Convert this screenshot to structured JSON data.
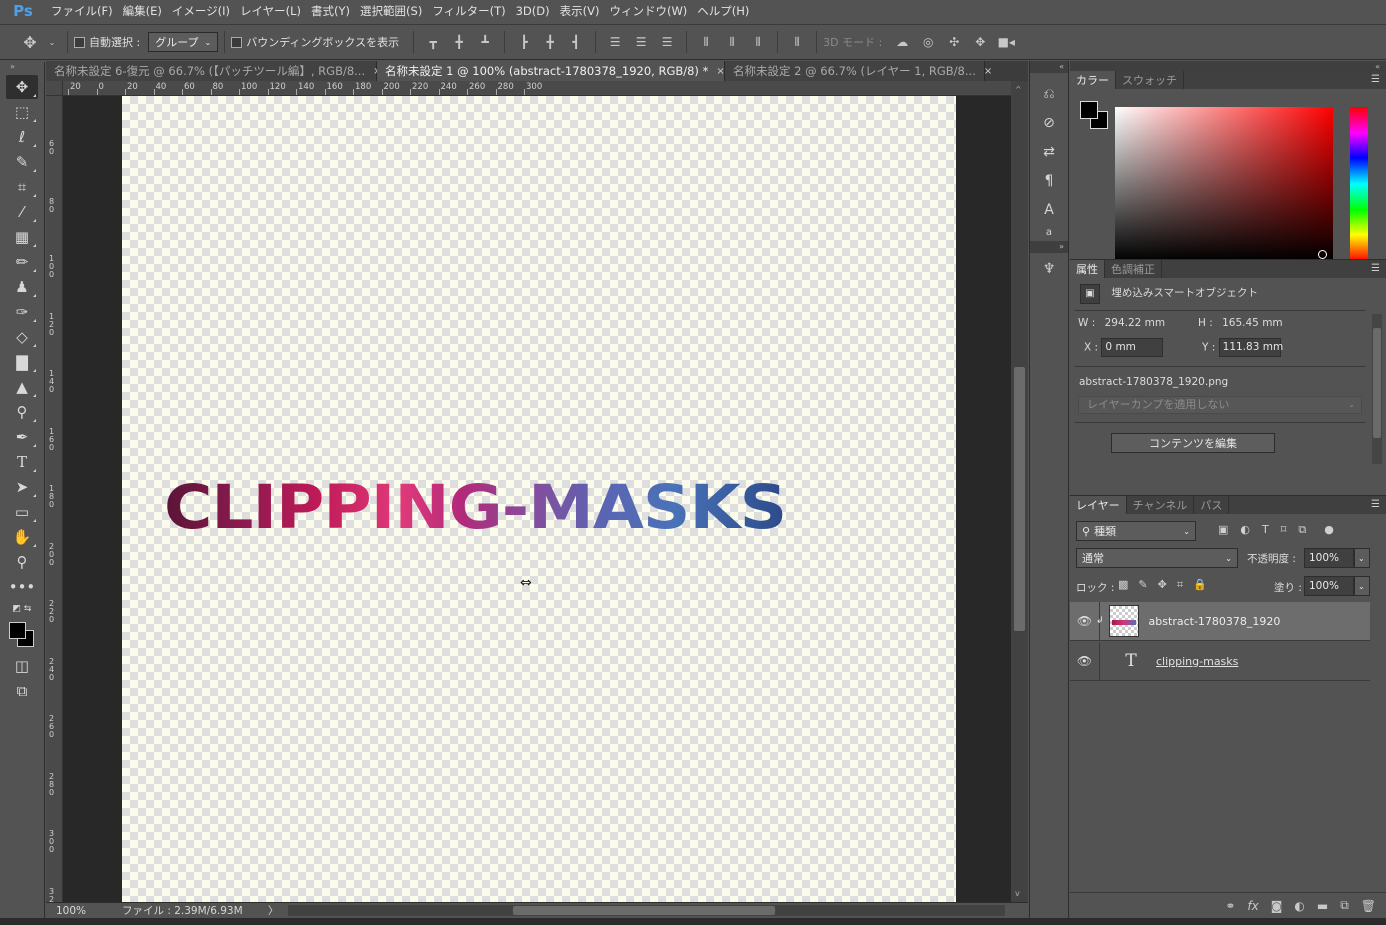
{
  "app": {
    "logo": "Ps"
  },
  "menu": [
    "ファイル(F)",
    "編集(E)",
    "イメージ(I)",
    "レイヤー(L)",
    "書式(Y)",
    "選択範囲(S)",
    "フィルター(T)",
    "3D(D)",
    "表示(V)",
    "ウィンドウ(W)",
    "ヘルプ(H)"
  ],
  "options": {
    "auto_select_label": "自動選択 :",
    "auto_select_value": "グループ",
    "bbox_label": "バウンディングボックスを表示",
    "mode3d_label": "3D モード :"
  },
  "tabs": [
    {
      "label": "名称未設定 6-復元 @ 66.7% (【パッチツール編】, RGB/8...",
      "close": "×"
    },
    {
      "label": "名称未設定 1 @ 100% (abstract-1780378_1920, RGB/8) *",
      "close": "×"
    },
    {
      "label": "名称未設定 2 @ 66.7% (レイヤー 1, RGB/8...",
      "close": "×"
    }
  ],
  "ruler_top": [
    "20",
    "0",
    "20",
    "40",
    "60",
    "80",
    "100",
    "120",
    "140",
    "160",
    "180",
    "200",
    "220",
    "240",
    "260",
    "280",
    "300"
  ],
  "ruler_left": [
    "6 0",
    "8 0",
    "1 0 0",
    "1 2 0",
    "1 4 0",
    "1 6 0",
    "1 8 0",
    "2 0 0",
    "2 2 0",
    "2 4 0",
    "2 6 0",
    "2 8 0",
    "3 0 0",
    "3 2 0"
  ],
  "canvas": {
    "text": "CLIPPING-MASKS"
  },
  "status": {
    "zoom": "100%",
    "file": "ファイル : 2.39M/6.93M",
    "arrow": "〉"
  },
  "color_panel": {
    "tabs": [
      "カラー",
      "スウォッチ"
    ]
  },
  "properties": {
    "tabs": [
      "属性",
      "色調補正"
    ],
    "type": "埋め込みスマートオブジェクト",
    "w_label": "W :",
    "w_value": "294.22 mm",
    "h_label": "H :",
    "h_value": "165.45 mm",
    "x_label": "X :",
    "x_value": "0 mm",
    "y_label": "Y :",
    "y_value": "111.83 mm",
    "filename": "abstract-1780378_1920.png",
    "comp_placeholder": "レイヤーカンプを適用しない",
    "edit_button": "コンテンツを編集"
  },
  "layers": {
    "tabs": [
      "レイヤー",
      "チャンネル",
      "パス"
    ],
    "filter_label": "種類",
    "blend_mode": "通常",
    "opacity_label": "不透明度 :",
    "opacity_value": "100%",
    "lock_label": "ロック :",
    "fill_label": "塗り :",
    "fill_value": "100%",
    "items": [
      {
        "name": "abstract-1780378_1920",
        "visible_icon": "eye-icon",
        "selected": true
      },
      {
        "name": "clipping-masks",
        "visible_icon": "eye-icon",
        "selected": false
      }
    ]
  }
}
